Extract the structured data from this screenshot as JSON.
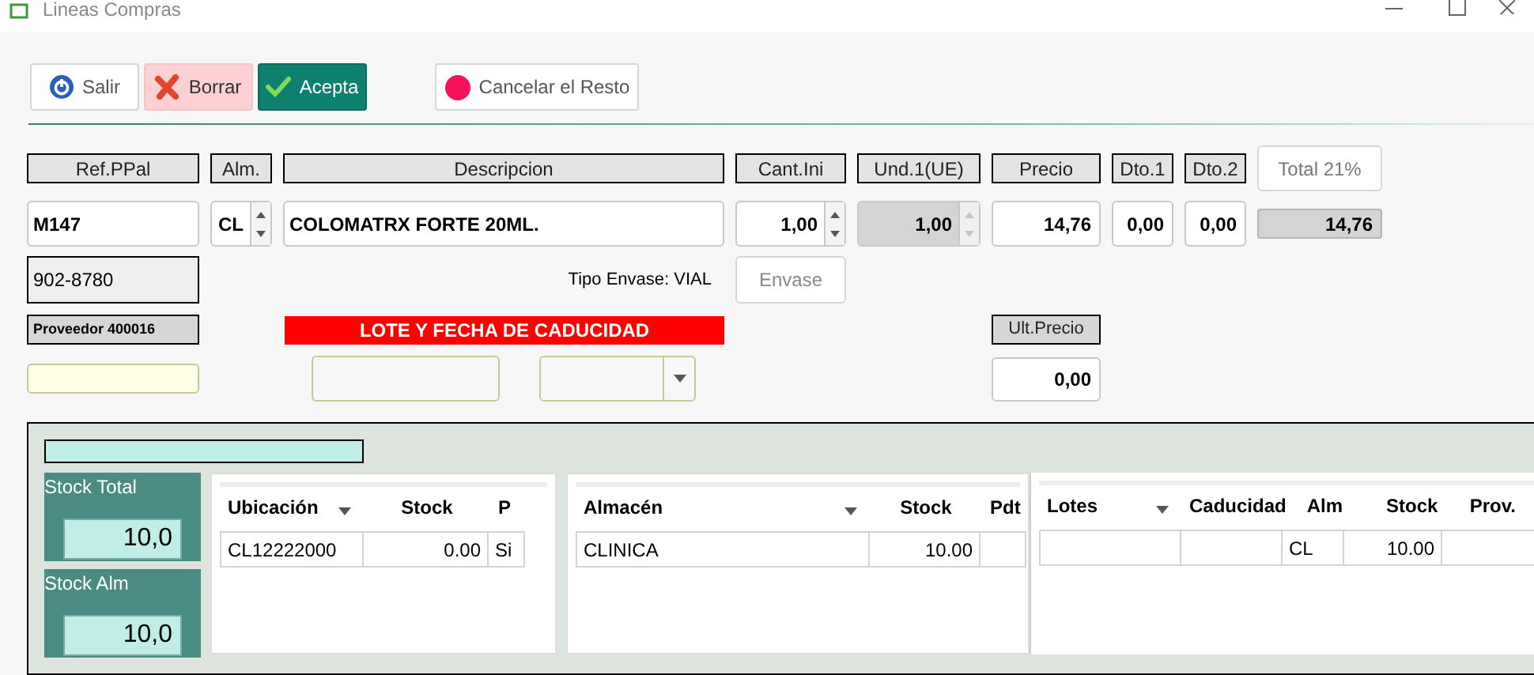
{
  "window": {
    "title": "Lineas Compras"
  },
  "toolbar": [
    {
      "label": "Salir",
      "kind": "exit"
    },
    {
      "label": "Borrar",
      "kind": "delete"
    },
    {
      "label": "Acepta",
      "kind": "accept"
    },
    {
      "label": "Cancelar el Resto",
      "kind": "cancel"
    }
  ],
  "headers": [
    {
      "label": "Ref.PPal",
      "kind": "label"
    },
    {
      "label": "Alm.",
      "kind": "label"
    },
    {
      "label": "Descripcion",
      "kind": "label"
    },
    {
      "label": "Cant.Ini",
      "kind": "label"
    },
    {
      "label": "Und.1(UE)",
      "kind": "label"
    },
    {
      "label": "Precio",
      "kind": "label"
    },
    {
      "label": "Dto.1",
      "kind": "label"
    },
    {
      "label": "Dto.2",
      "kind": "label"
    },
    {
      "label": "Total 21%",
      "kind": "button"
    }
  ],
  "fields": [
    {
      "value": "M147",
      "kind": "text"
    },
    {
      "value": "CL",
      "kind": "spinner",
      "disabled": false
    },
    {
      "value": "COLOMATRX FORTE 20ML.",
      "kind": "text"
    },
    {
      "value": "1,00",
      "kind": "spinner",
      "disabled": false
    },
    {
      "value": "1,00",
      "kind": "spinner",
      "disabled": true
    },
    {
      "value": "14,76",
      "kind": "number"
    },
    {
      "value": "0,00",
      "kind": "number"
    },
    {
      "value": "0,00",
      "kind": "number"
    },
    {
      "value": "14,76",
      "kind": "readonly"
    }
  ],
  "phone": "902-8780",
  "tipo_envase": "Tipo Envase: VIAL",
  "envase_button": "Envase",
  "proveedor": "Proveedor 400016",
  "lote_banner": "LOTE Y FECHA DE CADUCIDAD",
  "ult_precio": {
    "label": "Ult.Precio",
    "value": "0,00"
  },
  "stock": {
    "total_label": "Stock Total",
    "total": "10,0",
    "alm_label": "Stock Alm",
    "alm": "10,0"
  },
  "tables": [
    {
      "columns": [
        {
          "label": "Ubicación",
          "sortable": true,
          "numeric": false
        },
        {
          "label": "Stock",
          "sortable": false,
          "numeric": true
        },
        {
          "label": "P",
          "sortable": false,
          "numeric": false
        }
      ],
      "rows": [
        [
          "CL12222000",
          "0.00",
          "Si"
        ]
      ]
    },
    {
      "columns": [
        {
          "label": "Almacén",
          "sortable": true,
          "numeric": false
        },
        {
          "label": "Stock",
          "sortable": false,
          "numeric": true
        },
        {
          "label": "Pdt",
          "sortable": false,
          "numeric": false
        }
      ],
      "rows": [
        [
          "CLINICA",
          "10.00",
          null
        ]
      ]
    },
    {
      "columns": [
        {
          "label": "Lotes",
          "sortable": true,
          "numeric": false
        },
        {
          "label": "Caducidad",
          "sortable": false,
          "numeric": false
        },
        {
          "label": "Alm",
          "sortable": false,
          "numeric": false
        },
        {
          "label": "Stock",
          "sortable": false,
          "numeric": true
        },
        {
          "label": "Prov.",
          "sortable": false,
          "numeric": false
        }
      ],
      "rows": [
        [
          null,
          null,
          "CL",
          "10.00",
          null
        ]
      ]
    }
  ]
}
